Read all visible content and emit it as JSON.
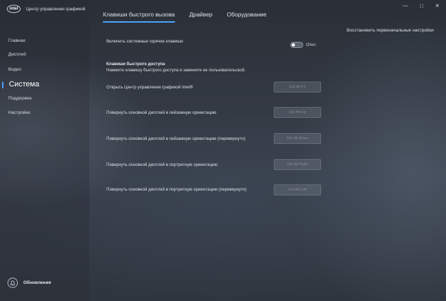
{
  "app": {
    "logo_text": "intel",
    "title": "Центр управления графикой"
  },
  "sidebar": {
    "items": [
      {
        "label": "Главная"
      },
      {
        "label": "Дисплей"
      },
      {
        "label": "Видео"
      },
      {
        "label": "Система",
        "active": true
      },
      {
        "label": "Поддержка"
      },
      {
        "label": "Настройки"
      }
    ],
    "updates_label": "Обновления",
    "updates_icon": "bell-icon"
  },
  "tabs": [
    {
      "label": "Клавиши быстрого вызова",
      "active": true
    },
    {
      "label": "Драйвер"
    },
    {
      "label": "Оборудование"
    }
  ],
  "window_controls": {
    "minimize": "—",
    "maximize": "□",
    "close": "✕"
  },
  "restore_defaults": "Восстановить первоначальные настройки",
  "system_hotkeys": {
    "label": "Включить системные горячие клавиши",
    "state": "Откл."
  },
  "hotkeys_section": {
    "title": "Клавиши быстрого доступа",
    "description": "Нажмите клавишу быстрого доступа и замените ее пользовательской.",
    "rows": [
      {
        "label": "Открыть Центр управления графикой Intel®",
        "key": "Ctrl Alt F1"
      },
      {
        "label": "Повернуть основной дисплей в пейзажную ориентацию",
        "key": "Ctrl Alt Up"
      },
      {
        "label": "Повернуть основной дисплей в пейзажную ориентацию (перевернуто)",
        "key": "Ctrl Alt Down"
      },
      {
        "label": "Повернуть основной дисплей в портретную ориентацию",
        "key": "Ctrl Alt Right"
      },
      {
        "label": "Повернуть основной дисплей в портретную ориентацию (перевернуто)",
        "key": "Ctrl Alt Left"
      }
    ]
  },
  "colors": {
    "accent": "#4da3ff"
  }
}
